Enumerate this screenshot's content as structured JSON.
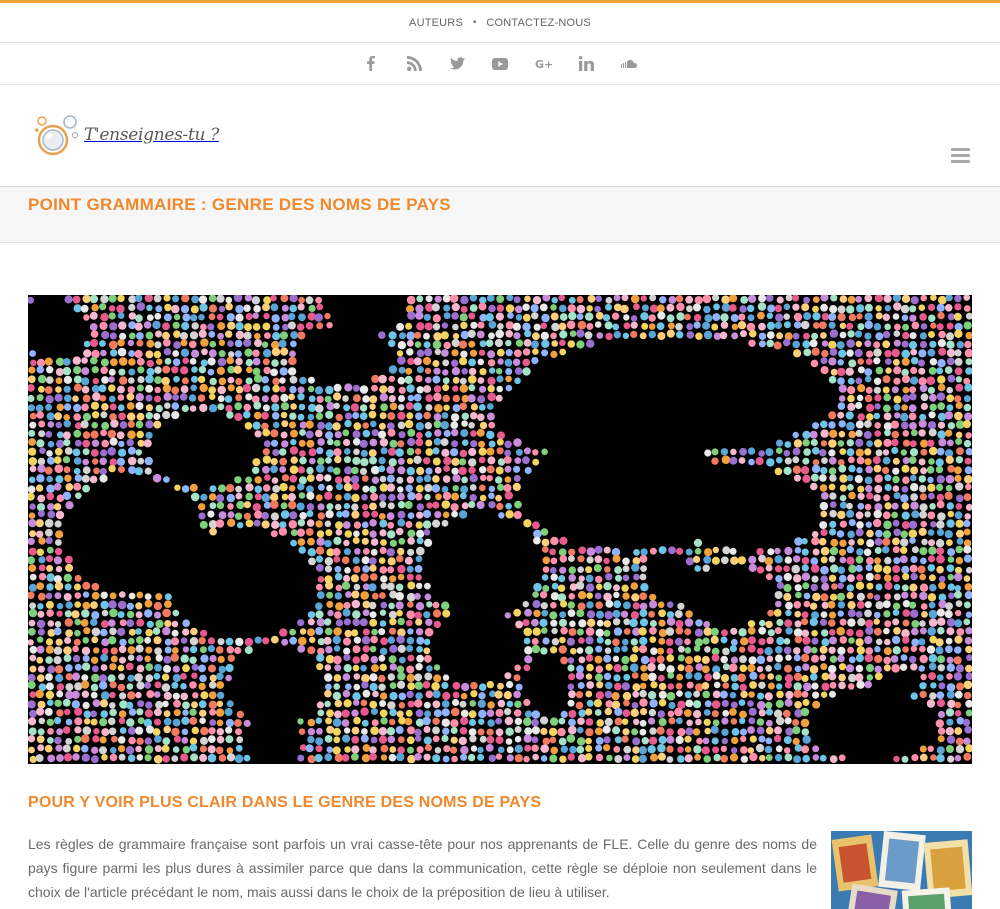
{
  "colors": {
    "accent": "#f0a338",
    "title": "#f0892d",
    "icon": "#9a9a9a"
  },
  "topnav": {
    "items": [
      {
        "label": "AUTEURS"
      },
      {
        "label": "CONTACTEZ-NOUS"
      }
    ],
    "separator": "•"
  },
  "social": {
    "icons": [
      "facebook-icon",
      "rss-icon",
      "twitter-icon",
      "youtube-icon",
      "google-plus-icon",
      "linkedin-icon",
      "soundcloud-icon"
    ]
  },
  "header": {
    "logo_text": "T'enseignes-tu ?",
    "menu_icon": "hamburger-menu-icon"
  },
  "page": {
    "title": "POINT GRAMMAIRE : GENRE DES NOMS DE PAYS"
  },
  "article": {
    "section_title": "POUR Y VOIR PLUS CLAIR DANS LE GENRE DES NOMS DE PAYS",
    "paragraph": "Les règles de grammaire française sont parfois un vrai casse-tête pour nos apprenants de FLE. Celle du genre des noms de pays figure parmi les plus dures à assimiler parce que dans la communication, cette règle se déploie non seulement dans le choix de l'article précédant le nom, mais aussi dans le choix de la préposition de lieu à utiliser."
  }
}
